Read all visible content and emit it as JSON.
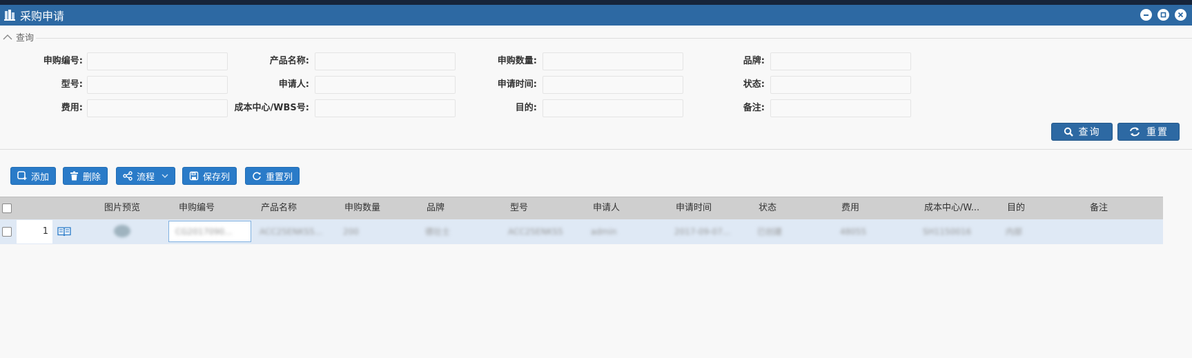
{
  "window": {
    "title": "采购申请"
  },
  "query": {
    "legend": "查询",
    "fields": [
      {
        "label": "申购编号:",
        "value": ""
      },
      {
        "label": "产品名称:",
        "value": ""
      },
      {
        "label": "申购数量:",
        "value": ""
      },
      {
        "label": "品牌:",
        "value": ""
      },
      {
        "label": "型号:",
        "value": ""
      },
      {
        "label": "申请人:",
        "value": ""
      },
      {
        "label": "申请时间:",
        "value": ""
      },
      {
        "label": "状态:",
        "value": ""
      },
      {
        "label": "费用:",
        "value": ""
      },
      {
        "label": "成本中心/WBS号:",
        "value": ""
      },
      {
        "label": "目的:",
        "value": ""
      },
      {
        "label": "备注:",
        "value": ""
      }
    ],
    "search_label": "查询",
    "reset_label": "重置"
  },
  "toolbar": {
    "add": "添加",
    "delete": "删除",
    "flow": "流程",
    "save_cols": "保存列",
    "reset_cols": "重置列"
  },
  "grid": {
    "columns": [
      "图片预览",
      "申购编号",
      "产品名称",
      "申购数量",
      "品牌",
      "型号",
      "申请人",
      "申请时间",
      "状态",
      "费用",
      "成本中心/W...",
      "目的",
      "备注"
    ],
    "rows": [
      {
        "num": "1",
        "cells": [
          "CG2017090...",
          "ACC25ENKS5...",
          "200",
          "德壮士",
          "ACC25ENKS5",
          "admin",
          "2017-09-07...",
          "已创建",
          "48055",
          "SH1150016",
          "内部"
        ]
      }
    ]
  },
  "colors": {
    "titlebar": "#2d69a3",
    "button": "#2a7bc8",
    "header": "#cfcfcf",
    "row": "#dfe9f5"
  }
}
